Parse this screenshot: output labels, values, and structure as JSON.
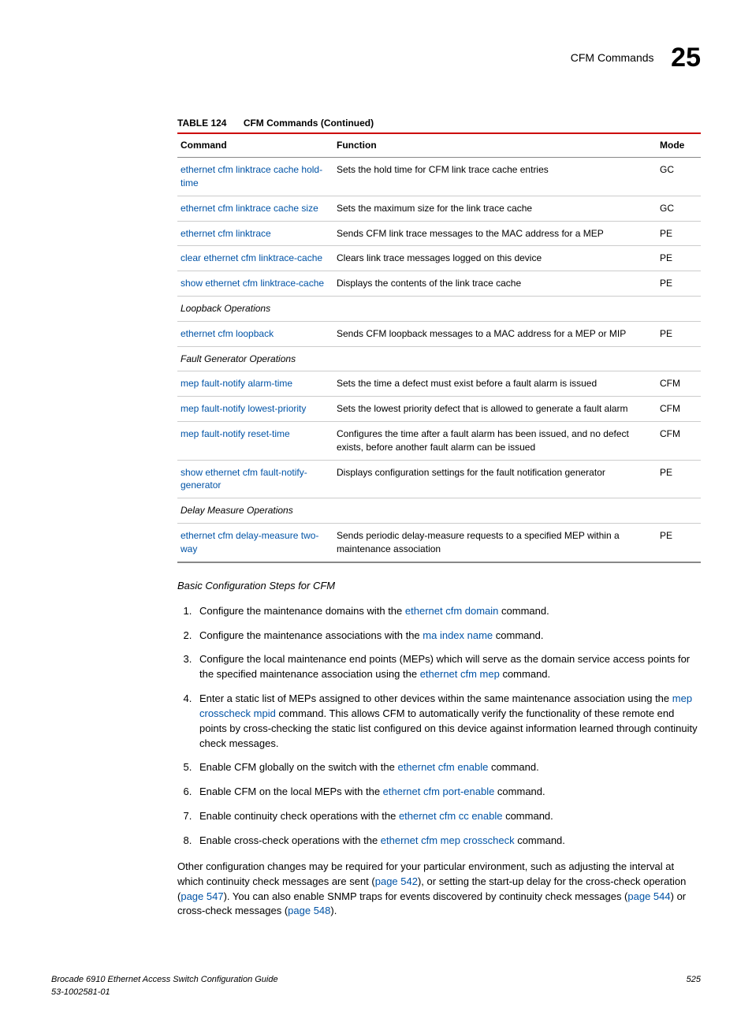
{
  "header": {
    "title": "CFM Commands",
    "chapter": "25"
  },
  "table": {
    "label": "TABLE 124",
    "title": "CFM Commands (Continued)",
    "headers": {
      "command": "Command",
      "function": "Function",
      "mode": "Mode"
    },
    "rows": [
      {
        "cmd": "ethernet cfm linktrace cache hold-time",
        "fn": "Sets the hold time for CFM link trace cache entries",
        "mode": "GC",
        "link": true
      },
      {
        "cmd": "ethernet cfm linktrace cache size",
        "fn": "Sets the maximum size for the link trace cache",
        "mode": "GC",
        "link": true
      },
      {
        "cmd": "ethernet cfm linktrace",
        "fn": "Sends CFM link trace messages to the MAC address for a MEP",
        "mode": "PE",
        "link": true
      },
      {
        "cmd": "clear ethernet cfm linktrace-cache",
        "fn": "Clears link trace messages logged on this device",
        "mode": "PE",
        "link": true
      },
      {
        "cmd": "show ethernet cfm linktrace-cache",
        "fn": "Displays the contents of the link trace cache",
        "mode": "PE",
        "link": true
      },
      {
        "cmd": "Loopback Operations",
        "group": true
      },
      {
        "cmd": "ethernet cfm loopback",
        "fn": "Sends CFM loopback messages to a MAC address for a MEP or MIP",
        "mode": "PE",
        "link": true
      },
      {
        "cmd": "Fault Generator Operations",
        "group": true
      },
      {
        "cmd": "mep fault-notify alarm-time",
        "fn": "Sets the time a defect must exist before a fault alarm is issued",
        "mode": "CFM",
        "link": true
      },
      {
        "cmd": "mep fault-notify lowest-priority",
        "fn": "Sets the lowest priority defect that is allowed to generate a fault alarm",
        "mode": "CFM",
        "link": true
      },
      {
        "cmd": "mep fault-notify reset-time",
        "fn": "Configures the time after a fault alarm has been issued, and no defect exists, before another fault alarm can be issued",
        "mode": "CFM",
        "link": true
      },
      {
        "cmd": "show ethernet cfm fault-notify-generator",
        "fn": "Displays configuration settings for the fault notification generator",
        "mode": "PE",
        "link": true
      },
      {
        "cmd": "Delay Measure Operations",
        "group": true
      },
      {
        "cmd": "ethernet cfm delay-measure two-way",
        "fn": "Sends periodic delay-measure requests to a specified MEP within a maintenance association",
        "mode": "PE",
        "link": true
      }
    ]
  },
  "section_title": "Basic Configuration Steps for CFM",
  "steps": [
    {
      "t1": "Configure the maintenance domains with the ",
      "l1": "ethernet cfm domain",
      "t2": " command."
    },
    {
      "t1": "Configure the maintenance associations with the ",
      "l1": "ma index name",
      "t2": " command."
    },
    {
      "t1": "Configure the local maintenance end points (MEPs) which will serve as the domain service access points for the specified maintenance association using the ",
      "l1": "ethernet cfm mep",
      "t2": " command."
    },
    {
      "t1": "Enter a static list of MEPs assigned to other devices within the same maintenance association using the ",
      "l1": "mep crosscheck mpid",
      "t2": " command. This allows CFM to automatically verify the functionality of these remote end points by cross-checking the static list configured on this device against information learned through continuity check messages."
    },
    {
      "t1": "Enable CFM globally on the switch with the ",
      "l1": "ethernet cfm enable",
      "t2": " command."
    },
    {
      "t1": "Enable CFM on the local MEPs with the ",
      "l1": "ethernet cfm port-enable",
      "t2": " command."
    },
    {
      "t1": "Enable continuity check operations with the ",
      "l1": "ethernet cfm cc enable",
      "t2": " command."
    },
    {
      "t1": "Enable cross-check operations with the ",
      "l1": "ethernet cfm mep crosscheck",
      "t2": " command."
    }
  ],
  "paragraph": {
    "p1": "Other configuration changes may be required for your particular environment, such as adjusting the interval at which continuity check messages are sent (",
    "l1": "page 542",
    "p2": "), or setting the start-up delay for the cross-check operation (",
    "l2": "page 547",
    "p3": "). You can also enable SNMP traps for events discovered by continuity check messages (",
    "l3": "page 544",
    "p4": ") or cross-check messages (",
    "l4": "page 548",
    "p5": ")."
  },
  "footer": {
    "left1": "Brocade 6910 Ethernet Access Switch Configuration Guide",
    "left2": "53-1002581-01",
    "right": "525"
  }
}
